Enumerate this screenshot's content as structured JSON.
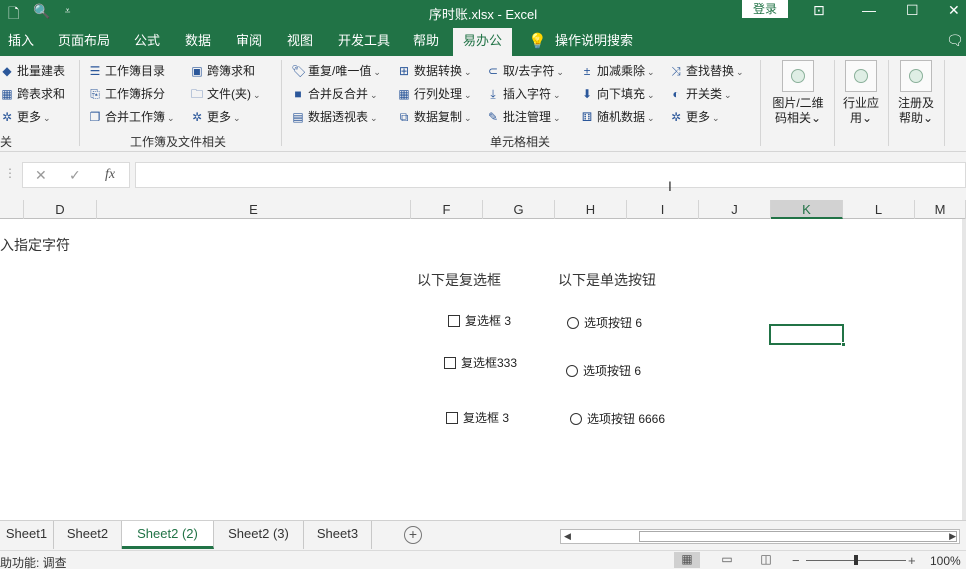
{
  "titlebar": {
    "title": "序时账.xlsx  -  Excel",
    "login": "登录",
    "icons": [
      "new-file-icon",
      "print-preview-icon",
      "qat-customize-icon"
    ]
  },
  "tabs": [
    {
      "label": "插入"
    },
    {
      "label": "页面布局"
    },
    {
      "label": "公式"
    },
    {
      "label": "数据"
    },
    {
      "label": "审阅"
    },
    {
      "label": "视图"
    },
    {
      "label": "开发工具"
    },
    {
      "label": "帮助"
    },
    {
      "label": "易办公",
      "active": true
    },
    {
      "label": "操作说明搜索"
    }
  ],
  "ribbon": {
    "group1": {
      "items": [
        "批量建表",
        "跨表求和",
        "更多"
      ],
      "label": "关"
    },
    "group2": {
      "items": [
        "工作簿目录",
        "工作簿拆分",
        "合并工作簿",
        "跨簿求和",
        "文件(夹)",
        "更多"
      ],
      "label": "工作簿及文件相关"
    },
    "group3": {
      "items": [
        "重复/唯一值",
        "合并反合并",
        "数据透视表",
        "数据转换",
        "行列处理",
        "数据复制",
        "取/去字符",
        "插入字符",
        "批注管理",
        "加减乘除",
        "向下填充",
        "随机数据",
        "查找替换",
        "开关类",
        "更多"
      ],
      "label": "单元格相关"
    },
    "big": [
      {
        "label1": "图片/二维",
        "label2": "码相关"
      },
      {
        "label1": "行业应",
        "label2": "用"
      },
      {
        "label1": "注册及",
        "label2": "帮助"
      }
    ]
  },
  "formula": {
    "fx": "fx",
    "value": ""
  },
  "columns": [
    "D",
    "E",
    "F",
    "G",
    "H",
    "I",
    "J",
    "K",
    "L",
    "M"
  ],
  "selected_column": "K",
  "sheet": {
    "text1": "入指定字符",
    "checkbox_header": "以下是复选框",
    "radio_header": "以下是单选按钮",
    "checkboxes": [
      "复选框 3",
      "复选框333",
      "复选框 3"
    ],
    "radios": [
      "选项按钮 6",
      "选项按钮 6",
      "选项按钮 6666"
    ]
  },
  "sheet_tabs": [
    {
      "label": "Sheet1"
    },
    {
      "label": "Sheet2"
    },
    {
      "label": "Sheet2 (2)",
      "active": true
    },
    {
      "label": "Sheet2 (3)"
    },
    {
      "label": "Sheet3"
    }
  ],
  "status": {
    "accessibility": "助功能: 调查",
    "zoom": "100%"
  },
  "colors": {
    "accent": "#217346",
    "ribbon_bg": "#f3f3f3"
  }
}
